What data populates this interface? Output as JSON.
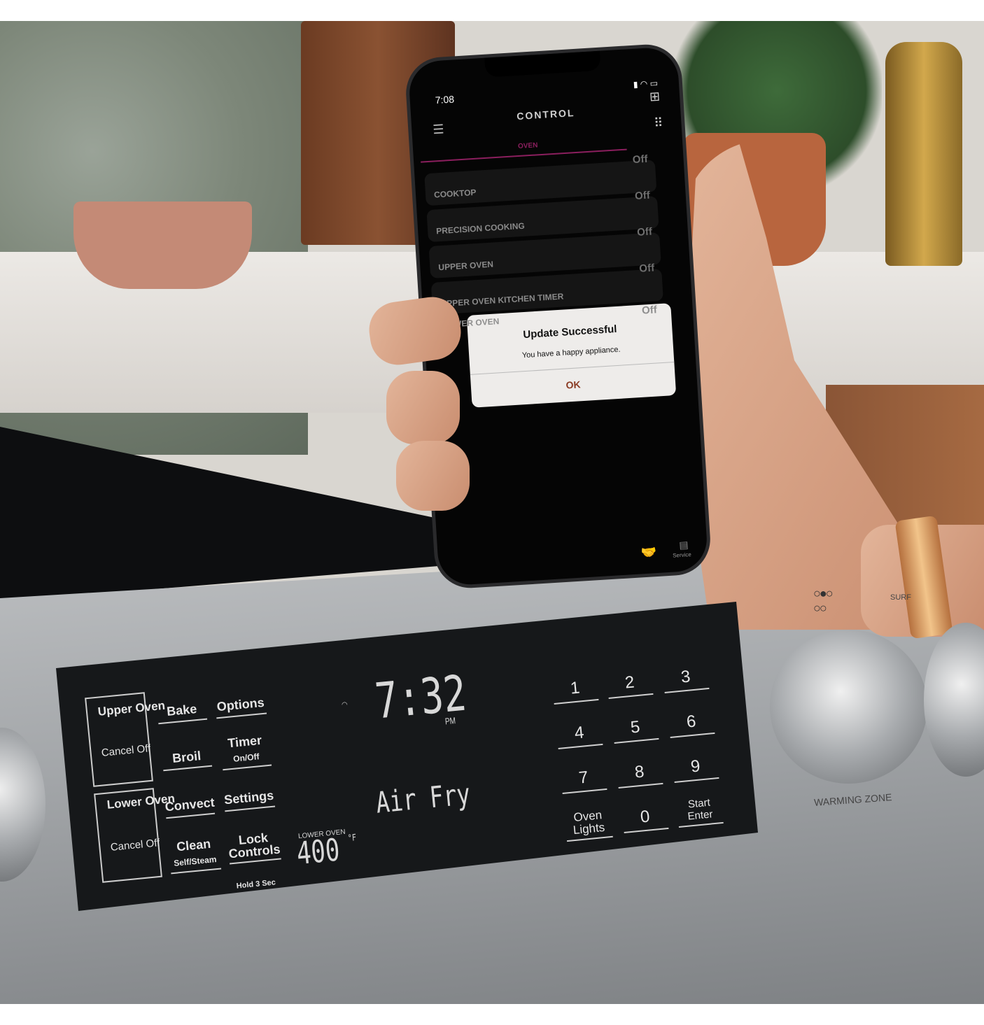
{
  "phone": {
    "status_time": "7:08",
    "title": "CONTROL",
    "tab": "OVEN",
    "accent_color": "#8b1f5e",
    "rows": [
      {
        "label": "COOKTOP",
        "value": "Off"
      },
      {
        "label": "PRECISION COOKING",
        "value": "Off"
      },
      {
        "label": "UPPER OVEN",
        "value": "Off"
      },
      {
        "label": "UPPER OVEN KITCHEN TIMER",
        "value": "Off"
      },
      {
        "label": "LOWER OVEN",
        "value": "Off"
      }
    ],
    "dialog": {
      "title": "Update Successful",
      "message": "You have a happy appliance.",
      "ok": "OK",
      "ok_color": "#8a3a22"
    },
    "bottom_nav": {
      "service": "Service"
    }
  },
  "oven_panel": {
    "clock": "7:32",
    "clock_suffix": "PM",
    "mode": "Air Fry",
    "lower_oven_label": "LOWER OVEN",
    "lower_oven_temp": "400",
    "temp_unit": "°F",
    "buttons": {
      "upper_oven": "Upper Oven",
      "upper_cancel": "Cancel Off",
      "lower_oven": "Lower Oven",
      "lower_cancel": "Cancel Off",
      "bake": "Bake",
      "options": "Options",
      "broil": "Broil",
      "timer": "Timer",
      "timer_sub": "On/Off",
      "convect": "Convect",
      "settings": "Settings",
      "clean": "Clean",
      "clean_sub": "Self/Steam",
      "lock": "Lock Controls",
      "lock_sub": "Hold 3 Sec",
      "keys": [
        "1",
        "2",
        "3",
        "4",
        "5",
        "6",
        "7",
        "8",
        "9",
        "0"
      ],
      "oven_lights": "Oven Lights",
      "start": "Start",
      "enter": "Enter"
    },
    "warming_zone": "WARMING ZONE",
    "surface_label": "SURF"
  }
}
